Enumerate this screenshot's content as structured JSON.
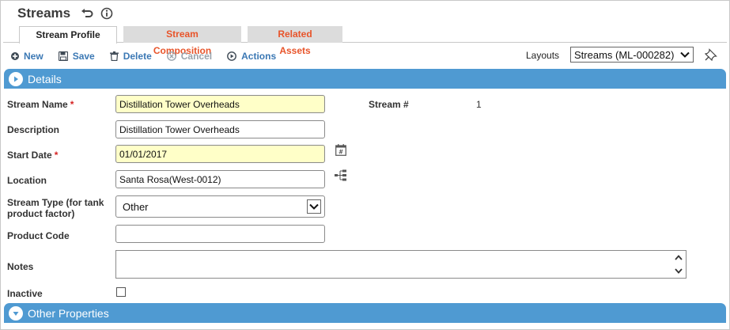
{
  "header": {
    "title": "Streams"
  },
  "tabs": [
    {
      "label": "Stream Profile",
      "active": true
    },
    {
      "label": "Stream Composition",
      "active": false
    },
    {
      "label": "Related Assets",
      "active": false
    }
  ],
  "toolbar": {
    "new_label": "New",
    "save_label": "Save",
    "delete_label": "Delete",
    "cancel_label": "Cancel",
    "actions_label": "Actions"
  },
  "layouts": {
    "label": "Layouts",
    "selected": "Streams (ML-000282)"
  },
  "sections": {
    "details": "Details",
    "other": "Other Properties"
  },
  "form": {
    "stream_name": {
      "label": "Stream Name",
      "value": "Distillation Tower Overheads",
      "required": true
    },
    "description": {
      "label": "Description",
      "value": "Distillation Tower Overheads"
    },
    "start_date": {
      "label": "Start Date",
      "value": "01/01/2017",
      "required": true
    },
    "location": {
      "label": "Location",
      "value": "Santa Rosa(West-0012)"
    },
    "stream_type": {
      "label_line1": "Stream Type (for tank",
      "label_line2": "product factor)",
      "value": "Other"
    },
    "product_code": {
      "label": "Product Code",
      "value": ""
    },
    "notes": {
      "label": "Notes",
      "value": ""
    },
    "inactive": {
      "label": "Inactive",
      "checked": false
    },
    "stream_number": {
      "label": "Stream #",
      "value": "1"
    }
  },
  "colors": {
    "accent": "#4f9ad2",
    "tab_inactive_text": "#e8542a",
    "link": "#3b78b4",
    "required_bg": "#ffffc8",
    "required_mark": "#d62424"
  },
  "required_mark": "*"
}
